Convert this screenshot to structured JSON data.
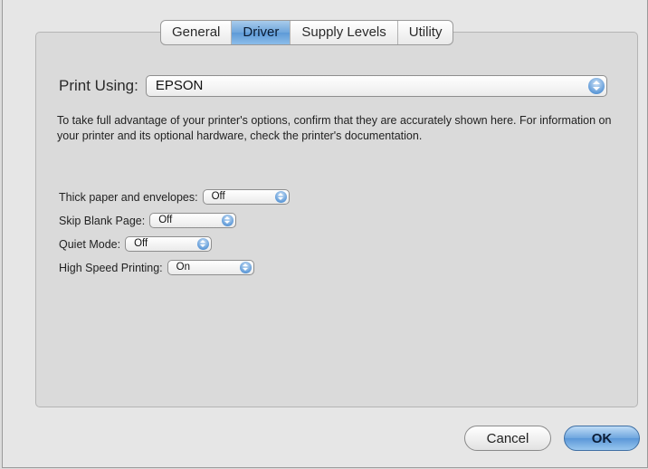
{
  "tabs": [
    {
      "label": "General",
      "active": false
    },
    {
      "label": "Driver",
      "active": true
    },
    {
      "label": "Supply Levels",
      "active": false
    },
    {
      "label": "Utility",
      "active": false
    }
  ],
  "print_using": {
    "label": "Print Using:",
    "value": "EPSON"
  },
  "info_text": "To take full advantage of your printer's options, confirm that they are accurately shown here. For information on your printer and its optional hardware, check the printer's documentation.",
  "options": [
    {
      "label": "Thick paper and envelopes:",
      "value": "Off"
    },
    {
      "label": "Skip Blank Page:",
      "value": "Off"
    },
    {
      "label": "Quiet Mode:",
      "value": "Off"
    },
    {
      "label": "High Speed Printing:",
      "value": "On"
    }
  ],
  "buttons": {
    "cancel": "Cancel",
    "ok": "OK"
  },
  "colors": {
    "accent": "#5e9ad7",
    "panel": "#dadada",
    "window": "#e6e6e6"
  }
}
